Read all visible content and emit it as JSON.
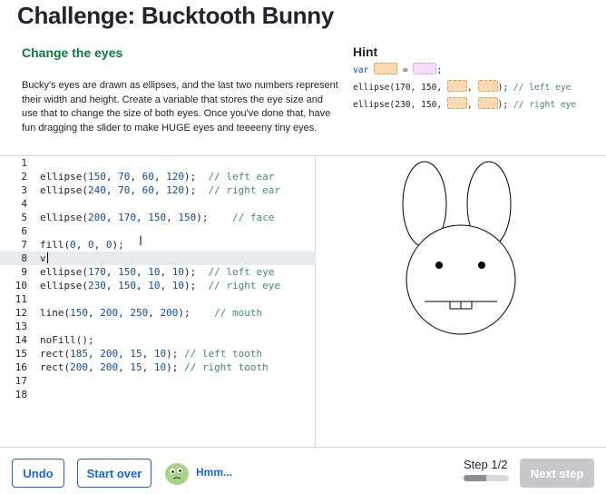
{
  "header": {
    "title": "Challenge: Bucktooth Bunny",
    "subtitle": "Change the eyes",
    "description": "Bucky's eyes are drawn as ellipses, and the last two numbers represent their width and height. Create a variable that stores the eye size and use that to change the size of both eyes. Once you've done that, have fun dragging the slider to make HUGE eyes and teeeeny tiny eyes."
  },
  "hint": {
    "title": "Hint",
    "line1": {
      "keyword": "var",
      "equals": "=",
      "semicolon": ";"
    },
    "line2": {
      "call": "ellipse(170, 150,",
      "sep": ",",
      "end": ");",
      "comment": "// left eye"
    },
    "line3": {
      "call": "ellipse(230, 150,",
      "sep": ",",
      "end": ");",
      "comment": "// right eye"
    }
  },
  "editor": {
    "active_line": 8,
    "lines": [
      {
        "n": "1",
        "code": ""
      },
      {
        "n": "2",
        "code": "ellipse(150, 70, 60, 120);  // left ear"
      },
      {
        "n": "3",
        "code": "ellipse(240, 70, 60, 120);  // right ear"
      },
      {
        "n": "4",
        "code": ""
      },
      {
        "n": "5",
        "code": "ellipse(200, 170, 150, 150);    // face"
      },
      {
        "n": "6",
        "code": ""
      },
      {
        "n": "7",
        "code": "fill(0, 0, 0);"
      },
      {
        "n": "8",
        "code": "v"
      },
      {
        "n": "9",
        "code": "ellipse(170, 150, 10, 10);  // left eye"
      },
      {
        "n": "10",
        "code": "ellipse(230, 150, 10, 10);  // right eye"
      },
      {
        "n": "11",
        "code": ""
      },
      {
        "n": "12",
        "code": "line(150, 200, 250, 200);    // mouth"
      },
      {
        "n": "13",
        "code": ""
      },
      {
        "n": "14",
        "code": "noFill();"
      },
      {
        "n": "15",
        "code": "rect(185, 200, 15, 10); // left tooth"
      },
      {
        "n": "16",
        "code": "rect(200, 200, 15, 10); // right tooth"
      },
      {
        "n": "17",
        "code": ""
      },
      {
        "n": "18",
        "code": ""
      }
    ]
  },
  "footer": {
    "undo_label": "Undo",
    "start_over_label": "Start over",
    "status_text": "Hmm...",
    "step_label": "Step 1/2",
    "step_progress": 0.5,
    "next_label": "Next step"
  },
  "colors": {
    "accent": "#1865f2",
    "subtitle_green": "#0b7a3e",
    "disabled": "#c6c8cc",
    "avatar_green": "#a8d48a"
  },
  "icons": {
    "avatar": "green-blob-avatar-icon",
    "cursor": "text-cursor-ibeam-icon"
  }
}
